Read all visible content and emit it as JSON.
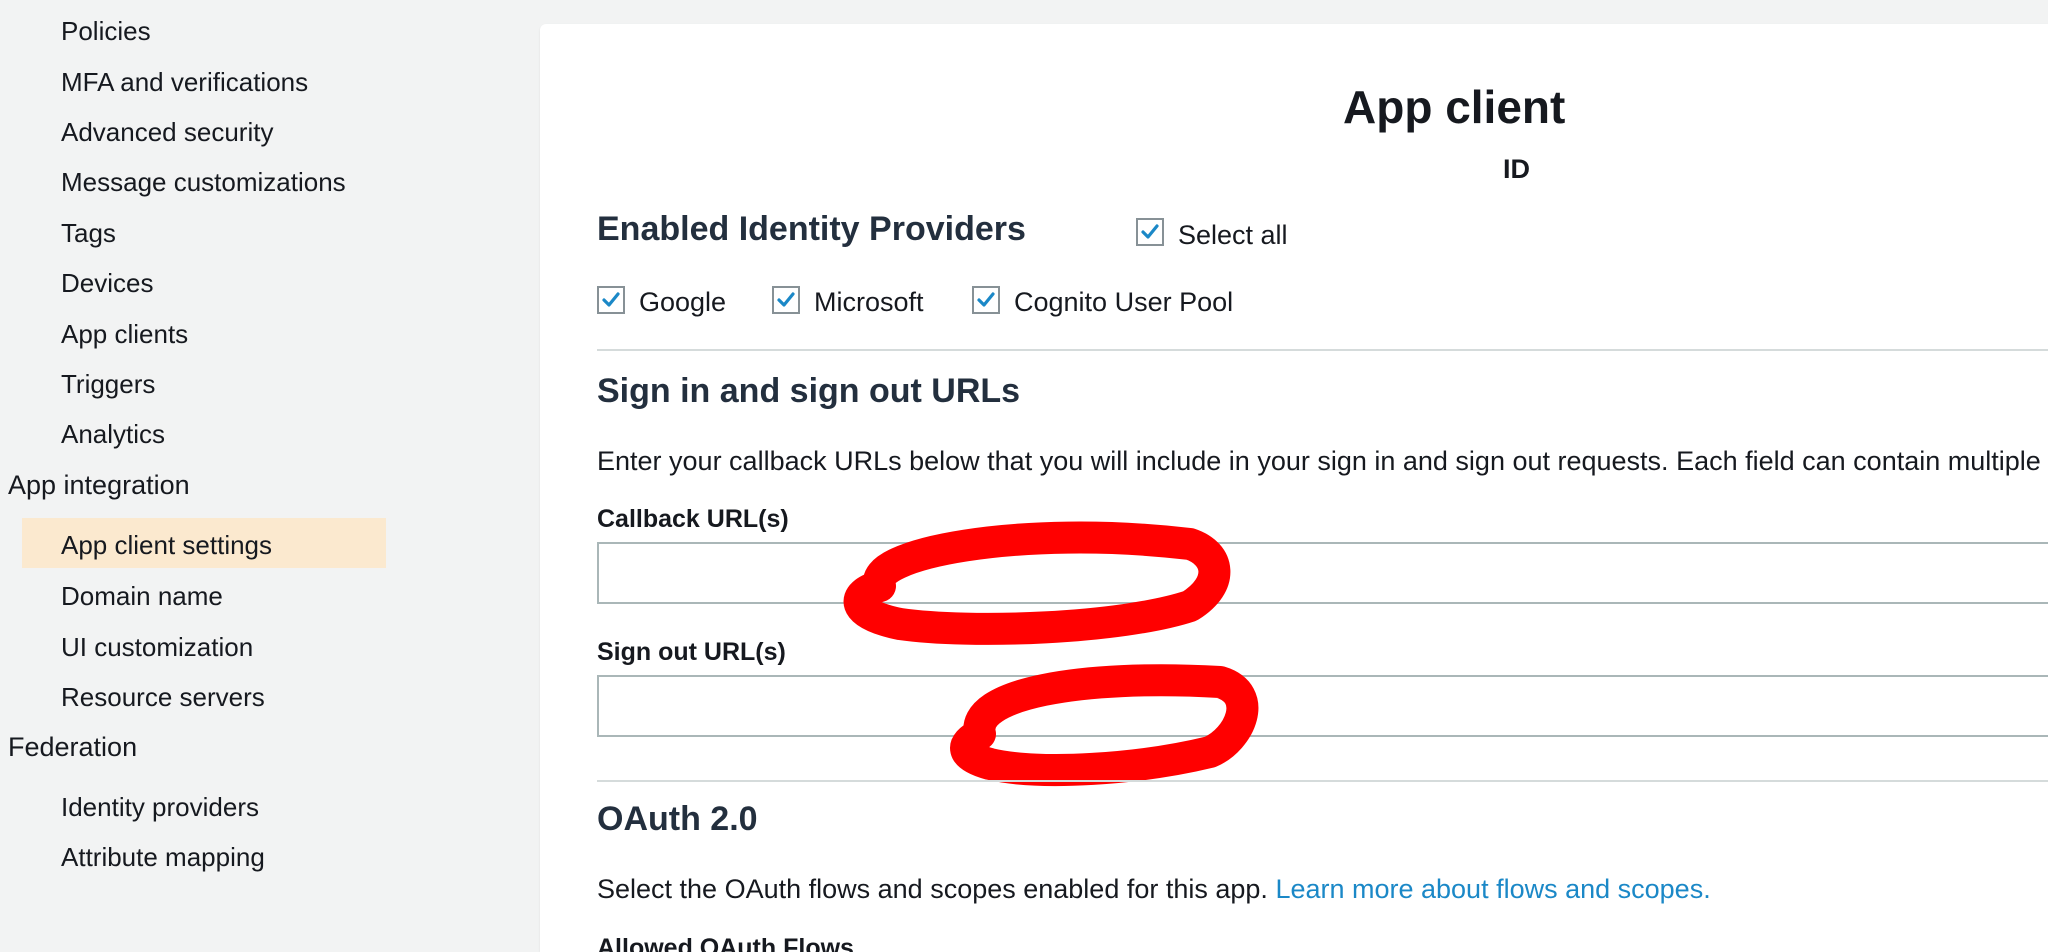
{
  "sidebar": {
    "items": [
      {
        "label": "Policies"
      },
      {
        "label": "MFA and verifications"
      },
      {
        "label": "Advanced security"
      },
      {
        "label": "Message customizations"
      },
      {
        "label": "Tags"
      },
      {
        "label": "Devices"
      },
      {
        "label": "App clients"
      },
      {
        "label": "Triggers"
      },
      {
        "label": "Analytics"
      }
    ],
    "app_integration": {
      "label": "App integration",
      "items": [
        {
          "label": "App client settings",
          "active": true
        },
        {
          "label": "Domain name"
        },
        {
          "label": "UI customization"
        },
        {
          "label": "Resource servers"
        }
      ]
    },
    "federation": {
      "label": "Federation",
      "items": [
        {
          "label": "Identity providers"
        },
        {
          "label": "Attribute mapping"
        }
      ]
    }
  },
  "main": {
    "title": "App client",
    "id_label": "ID",
    "identity_providers": {
      "heading": "Enabled Identity Providers",
      "select_all": {
        "label": "Select all",
        "checked": true
      },
      "providers": [
        {
          "label": "Google",
          "checked": true
        },
        {
          "label": "Microsoft",
          "checked": true
        },
        {
          "label": "Cognito User Pool",
          "checked": true
        }
      ]
    },
    "urls": {
      "heading": "Sign in and sign out URLs",
      "description": "Enter your callback URLs below that you will include in your sign in and sign out requests. Each field can contain multiple",
      "callback": {
        "label": "Callback URL(s)",
        "value": ""
      },
      "signout": {
        "label": "Sign out URL(s)",
        "value": ""
      }
    },
    "oauth": {
      "heading": "OAuth 2.0",
      "description": "Select the OAuth flows and scopes enabled for this app.",
      "link": "Learn more about flows and scopes.",
      "flows_label": "Allowed OAuth Flows"
    }
  },
  "colors": {
    "sidebar_bg": "#f2f3f3",
    "active_item_bg": "#fbe9cf",
    "checkbox_check": "#1b88c7",
    "link": "#1b88c7",
    "redaction": "#ff0000"
  },
  "icons": {
    "checkbox": "check-icon",
    "redaction": "red-scribble"
  }
}
